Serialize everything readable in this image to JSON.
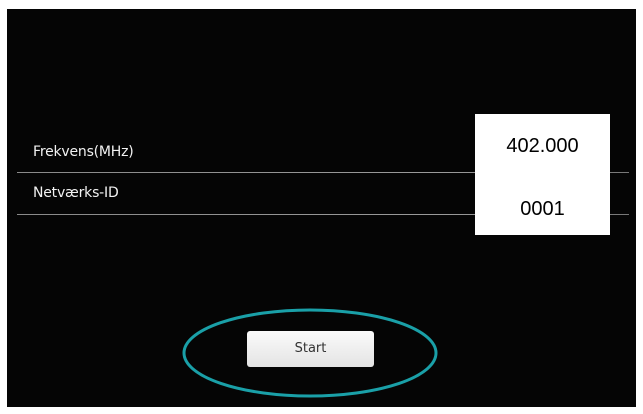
{
  "settings": {
    "frequency": {
      "label": "Frekvens(MHz)",
      "value": "402.000"
    },
    "network_id": {
      "label": "Netværks-ID",
      "value": "0001"
    }
  },
  "actions": {
    "start_label": "Start"
  },
  "colors": {
    "screen_background": "#050505",
    "highlight_ring": "#1aa0a8",
    "value_box": "#ffffff"
  }
}
